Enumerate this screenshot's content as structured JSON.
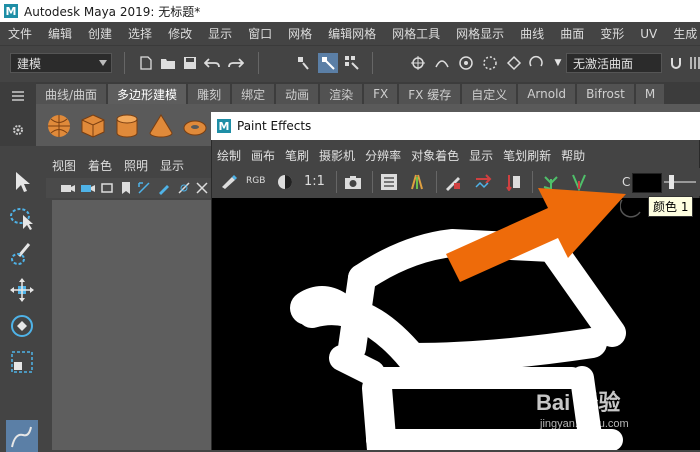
{
  "window": {
    "title": "Autodesk Maya 2019: 无标题*",
    "logo_letter": "M"
  },
  "menu": [
    "文件",
    "编辑",
    "创建",
    "选择",
    "修改",
    "显示",
    "窗口",
    "网格",
    "编辑网格",
    "网格工具",
    "网格显示",
    "曲线",
    "曲面",
    "变形",
    "UV",
    "生成"
  ],
  "statusline": {
    "mode_value": "建模",
    "live_surface": "无激活曲面"
  },
  "shelf": {
    "tabs": [
      "曲线/曲面",
      "多边形建模",
      "雕刻",
      "绑定",
      "动画",
      "渲染",
      "FX",
      "FX 缓存",
      "自定义",
      "Arnold",
      "Bifrost",
      "M"
    ],
    "active_tab": "多边形建模",
    "tool_icons": [
      "sphere-icon",
      "cube-icon",
      "cylinder-icon",
      "cone-icon",
      "torus-icon",
      "plane-icon"
    ]
  },
  "panel": {
    "menu": [
      "视图",
      "着色",
      "照明",
      "显示"
    ]
  },
  "paint_effects": {
    "title": "Paint Effects",
    "menu": [
      "绘制",
      "画布",
      "笔刷",
      "摄影机",
      "分辨率",
      "对象着色",
      "显示",
      "笔划刷新",
      "帮助"
    ],
    "rgb_label": "RGB",
    "ratio_label": "1:1",
    "color_label_prefix": "C",
    "color_tooltip": "颜色 1",
    "color_swatch": "#000000",
    "slider_value": 0.2
  },
  "watermark": {
    "brand": "Bai 经验",
    "url": "jingyan.baidu.com"
  },
  "colors": {
    "accent_orange": "#ee6b0a",
    "maya_blue": "#1e8ea6",
    "canvas_bg": "#000000",
    "stroke": "#ffffff"
  }
}
